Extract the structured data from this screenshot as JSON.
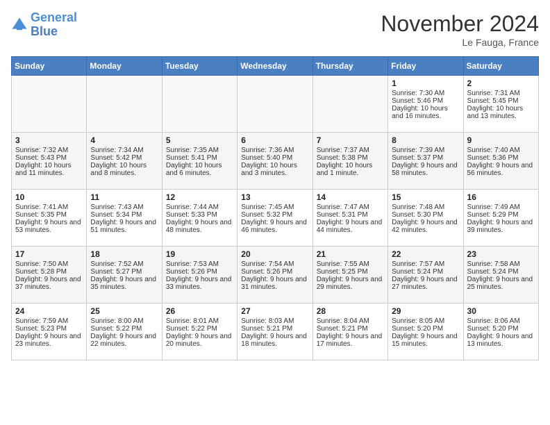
{
  "header": {
    "logo_line1": "General",
    "logo_line2": "Blue",
    "month": "November 2024",
    "location": "Le Fauga, France"
  },
  "days_of_week": [
    "Sunday",
    "Monday",
    "Tuesday",
    "Wednesday",
    "Thursday",
    "Friday",
    "Saturday"
  ],
  "weeks": [
    [
      {
        "day": "",
        "sunrise": "",
        "sunset": "",
        "daylight": ""
      },
      {
        "day": "",
        "sunrise": "",
        "sunset": "",
        "daylight": ""
      },
      {
        "day": "",
        "sunrise": "",
        "sunset": "",
        "daylight": ""
      },
      {
        "day": "",
        "sunrise": "",
        "sunset": "",
        "daylight": ""
      },
      {
        "day": "",
        "sunrise": "",
        "sunset": "",
        "daylight": ""
      },
      {
        "day": "1",
        "sunrise": "Sunrise: 7:30 AM",
        "sunset": "Sunset: 5:46 PM",
        "daylight": "Daylight: 10 hours and 16 minutes."
      },
      {
        "day": "2",
        "sunrise": "Sunrise: 7:31 AM",
        "sunset": "Sunset: 5:45 PM",
        "daylight": "Daylight: 10 hours and 13 minutes."
      }
    ],
    [
      {
        "day": "3",
        "sunrise": "Sunrise: 7:32 AM",
        "sunset": "Sunset: 5:43 PM",
        "daylight": "Daylight: 10 hours and 11 minutes."
      },
      {
        "day": "4",
        "sunrise": "Sunrise: 7:34 AM",
        "sunset": "Sunset: 5:42 PM",
        "daylight": "Daylight: 10 hours and 8 minutes."
      },
      {
        "day": "5",
        "sunrise": "Sunrise: 7:35 AM",
        "sunset": "Sunset: 5:41 PM",
        "daylight": "Daylight: 10 hours and 6 minutes."
      },
      {
        "day": "6",
        "sunrise": "Sunrise: 7:36 AM",
        "sunset": "Sunset: 5:40 PM",
        "daylight": "Daylight: 10 hours and 3 minutes."
      },
      {
        "day": "7",
        "sunrise": "Sunrise: 7:37 AM",
        "sunset": "Sunset: 5:38 PM",
        "daylight": "Daylight: 10 hours and 1 minute."
      },
      {
        "day": "8",
        "sunrise": "Sunrise: 7:39 AM",
        "sunset": "Sunset: 5:37 PM",
        "daylight": "Daylight: 9 hours and 58 minutes."
      },
      {
        "day": "9",
        "sunrise": "Sunrise: 7:40 AM",
        "sunset": "Sunset: 5:36 PM",
        "daylight": "Daylight: 9 hours and 56 minutes."
      }
    ],
    [
      {
        "day": "10",
        "sunrise": "Sunrise: 7:41 AM",
        "sunset": "Sunset: 5:35 PM",
        "daylight": "Daylight: 9 hours and 53 minutes."
      },
      {
        "day": "11",
        "sunrise": "Sunrise: 7:43 AM",
        "sunset": "Sunset: 5:34 PM",
        "daylight": "Daylight: 9 hours and 51 minutes."
      },
      {
        "day": "12",
        "sunrise": "Sunrise: 7:44 AM",
        "sunset": "Sunset: 5:33 PM",
        "daylight": "Daylight: 9 hours and 48 minutes."
      },
      {
        "day": "13",
        "sunrise": "Sunrise: 7:45 AM",
        "sunset": "Sunset: 5:32 PM",
        "daylight": "Daylight: 9 hours and 46 minutes."
      },
      {
        "day": "14",
        "sunrise": "Sunrise: 7:47 AM",
        "sunset": "Sunset: 5:31 PM",
        "daylight": "Daylight: 9 hours and 44 minutes."
      },
      {
        "day": "15",
        "sunrise": "Sunrise: 7:48 AM",
        "sunset": "Sunset: 5:30 PM",
        "daylight": "Daylight: 9 hours and 42 minutes."
      },
      {
        "day": "16",
        "sunrise": "Sunrise: 7:49 AM",
        "sunset": "Sunset: 5:29 PM",
        "daylight": "Daylight: 9 hours and 39 minutes."
      }
    ],
    [
      {
        "day": "17",
        "sunrise": "Sunrise: 7:50 AM",
        "sunset": "Sunset: 5:28 PM",
        "daylight": "Daylight: 9 hours and 37 minutes."
      },
      {
        "day": "18",
        "sunrise": "Sunrise: 7:52 AM",
        "sunset": "Sunset: 5:27 PM",
        "daylight": "Daylight: 9 hours and 35 minutes."
      },
      {
        "day": "19",
        "sunrise": "Sunrise: 7:53 AM",
        "sunset": "Sunset: 5:26 PM",
        "daylight": "Daylight: 9 hours and 33 minutes."
      },
      {
        "day": "20",
        "sunrise": "Sunrise: 7:54 AM",
        "sunset": "Sunset: 5:26 PM",
        "daylight": "Daylight: 9 hours and 31 minutes."
      },
      {
        "day": "21",
        "sunrise": "Sunrise: 7:55 AM",
        "sunset": "Sunset: 5:25 PM",
        "daylight": "Daylight: 9 hours and 29 minutes."
      },
      {
        "day": "22",
        "sunrise": "Sunrise: 7:57 AM",
        "sunset": "Sunset: 5:24 PM",
        "daylight": "Daylight: 9 hours and 27 minutes."
      },
      {
        "day": "23",
        "sunrise": "Sunrise: 7:58 AM",
        "sunset": "Sunset: 5:24 PM",
        "daylight": "Daylight: 9 hours and 25 minutes."
      }
    ],
    [
      {
        "day": "24",
        "sunrise": "Sunrise: 7:59 AM",
        "sunset": "Sunset: 5:23 PM",
        "daylight": "Daylight: 9 hours and 23 minutes."
      },
      {
        "day": "25",
        "sunrise": "Sunrise: 8:00 AM",
        "sunset": "Sunset: 5:22 PM",
        "daylight": "Daylight: 9 hours and 22 minutes."
      },
      {
        "day": "26",
        "sunrise": "Sunrise: 8:01 AM",
        "sunset": "Sunset: 5:22 PM",
        "daylight": "Daylight: 9 hours and 20 minutes."
      },
      {
        "day": "27",
        "sunrise": "Sunrise: 8:03 AM",
        "sunset": "Sunset: 5:21 PM",
        "daylight": "Daylight: 9 hours and 18 minutes."
      },
      {
        "day": "28",
        "sunrise": "Sunrise: 8:04 AM",
        "sunset": "Sunset: 5:21 PM",
        "daylight": "Daylight: 9 hours and 17 minutes."
      },
      {
        "day": "29",
        "sunrise": "Sunrise: 8:05 AM",
        "sunset": "Sunset: 5:20 PM",
        "daylight": "Daylight: 9 hours and 15 minutes."
      },
      {
        "day": "30",
        "sunrise": "Sunrise: 8:06 AM",
        "sunset": "Sunset: 5:20 PM",
        "daylight": "Daylight: 9 hours and 13 minutes."
      }
    ]
  ]
}
